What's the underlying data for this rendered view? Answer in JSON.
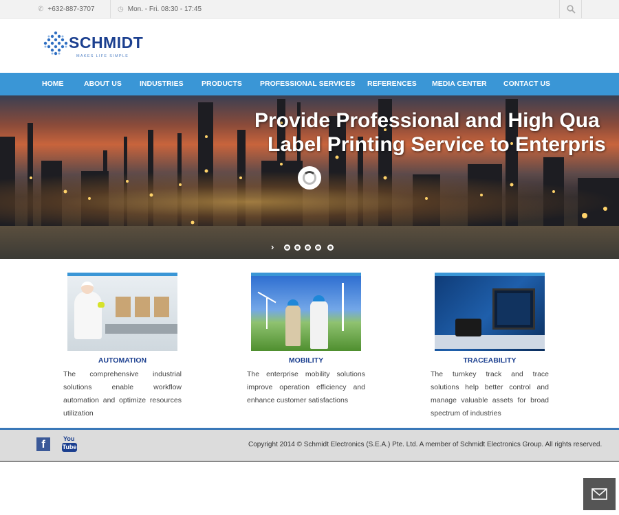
{
  "topbar": {
    "phone": "+632-887-3707",
    "hours": "Mon. - Fri. 08:30 - 17:45",
    "phone_icon": "phone-icon",
    "clock_icon": "clock-icon",
    "search_icon": "search-icon"
  },
  "logo": {
    "name": "SCHMIDT",
    "tagline": "MAKES LIFE SIMPLE"
  },
  "nav": {
    "items": [
      {
        "label": "HOME"
      },
      {
        "label": "ABOUT US"
      },
      {
        "label": "INDUSTRIES"
      },
      {
        "label": "PRODUCTS"
      },
      {
        "label": "PROFESSIONAL SERVICES"
      },
      {
        "label": "REFERENCES"
      },
      {
        "label": "MEDIA CENTER"
      },
      {
        "label": "CONTACT US"
      }
    ]
  },
  "hero": {
    "headline_line1": "Provide Professional and High Qua",
    "headline_line2": "Label Printing Service to Enterpris",
    "arrow": "›"
  },
  "features": [
    {
      "title": "AUTOMATION",
      "description": "The comprehensive industrial solutions enable workflow automation and optimize resources utilization"
    },
    {
      "title": "MOBILITY",
      "description": "The enterprise mobility solutions improve operation efficiency and enhance customer satisfactions"
    },
    {
      "title": "TRACEABILITY",
      "description": "The turnkey track and trace solutions help better control and manage valuable assets for broad spectrum of industries"
    }
  ],
  "footer": {
    "facebook_glyph": "f",
    "youtube_top": "You",
    "youtube_bottom": "Tube",
    "copyright": "Copyright 2014 © Schmidt Electronics (S.E.A.) Pte. Ltd. A member of Schmidt Electronics Group. All rights reserved."
  },
  "colors": {
    "nav_bg": "#3a96d6",
    "brand_blue": "#1b3f8f",
    "footer_bg": "#dcdcdc"
  }
}
